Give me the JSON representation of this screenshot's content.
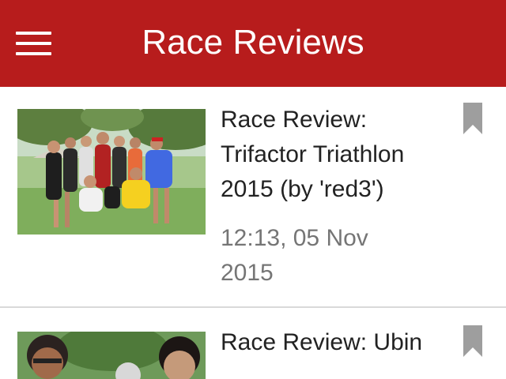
{
  "header": {
    "title": "Race Reviews",
    "menu_icon": "hamburger-menu-icon",
    "color": "#b71c1c"
  },
  "list": {
    "items": [
      {
        "title": "Race Review: Trifactor Triathlon 2015 (by 'red3')",
        "date": "12:13, 05 Nov 2015",
        "thumbnail": "group-photo-triathletes",
        "bookmark_icon": "bookmark-icon"
      },
      {
        "title": "Race Review: Ubin",
        "thumbnail": "group-photo-runners",
        "bookmark_icon": "bookmark-icon"
      }
    ]
  }
}
